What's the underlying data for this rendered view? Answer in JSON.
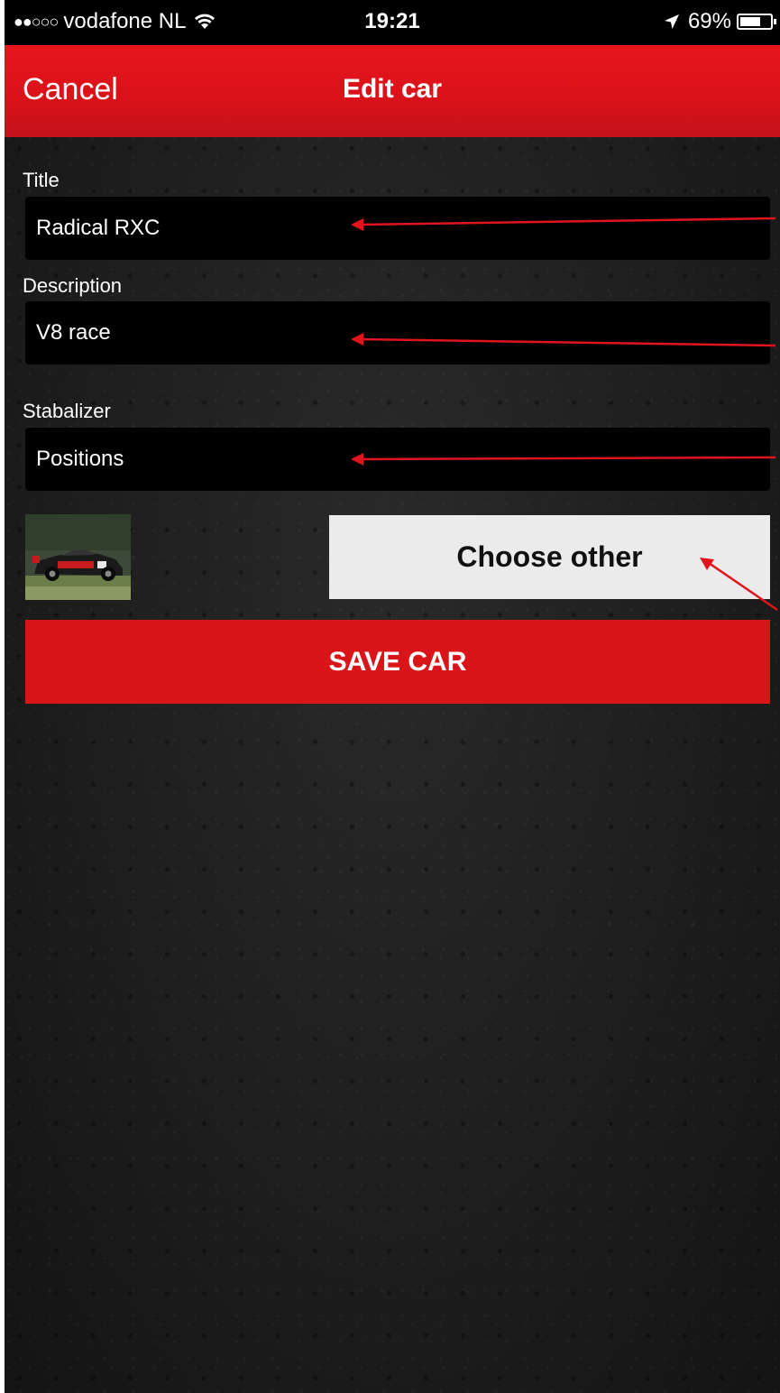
{
  "status_bar": {
    "signal": "●●○○○",
    "carrier": "vodafone NL",
    "time": "19:21",
    "battery_percent": "69%",
    "battery_level": 0.69
  },
  "nav": {
    "cancel_label": "Cancel",
    "title": "Edit car"
  },
  "form": {
    "title_label": "Title",
    "title_value": "Radical RXC",
    "description_label": "Description",
    "description_value": "V8 race",
    "stabalizer_label": "Stabalizer",
    "stabalizer_value": "Positions"
  },
  "image_button_label": "Choose other",
  "save_button_label": "SAVE CAR",
  "colors": {
    "nav_red": "#e8151c",
    "save_red": "#d91519",
    "annotation_arrow": "#e0141c"
  }
}
